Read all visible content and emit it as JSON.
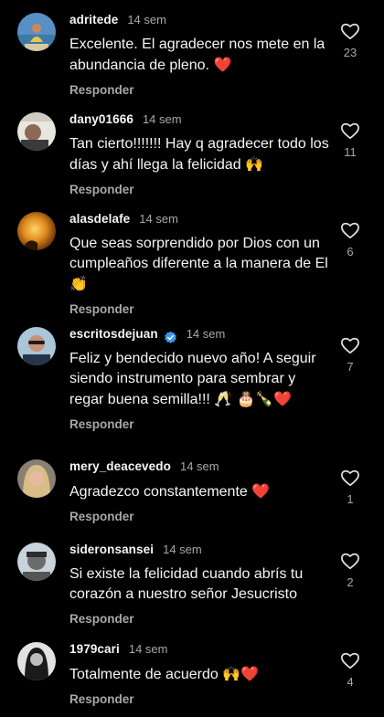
{
  "reply_label": "Responder",
  "comments": [
    {
      "username": "adritede",
      "time": "14 sem",
      "text": "Excelente.  El agradecer nos mete en la abundancia de pleno.",
      "emoji": "❤️",
      "likes": "23",
      "avatar_icon": "avatar-beach-photo"
    },
    {
      "username": "dany01666",
      "time": "14 sem",
      "text": "Tan cierto!!!!!!! Hay q agradecer todo los días y ahí llega la felicidad",
      "emoji": "🙌",
      "likes": "11",
      "avatar_icon": "avatar-man-photo"
    },
    {
      "username": "alasdelafe",
      "time": "14 sem",
      "text": "Que seas sorprendido por Dios con un cumpleaños diferente a la manera de El",
      "emoji": "👏",
      "likes": "6",
      "avatar_icon": "avatar-sunset-photo"
    },
    {
      "username": "escritosdejuan",
      "time": "14 sem",
      "text": "Feliz y bendecido nuevo año! A seguir siendo instrumento para sembrar y regar buena semilla!!!",
      "emoji": "🥂 🎂🍾❤️",
      "likes": "7",
      "avatar_icon": "avatar-man-sunglasses-photo",
      "verified": true
    },
    {
      "username": "mery_deacevedo",
      "time": "14 sem",
      "text": "Agradezco constantemente",
      "emoji": "❤️",
      "likes": "1",
      "avatar_icon": "avatar-woman-blonde-photo"
    },
    {
      "username": "sideronsansei",
      "time": "14 sem",
      "text": "Si existe la felicidad cuando abrís tu corazón a nuestro señor Jesucristo",
      "emoji": "",
      "likes": "2",
      "avatar_icon": "avatar-man-hat-photo"
    },
    {
      "username": "1979cari",
      "time": "14 sem",
      "text": "Totalmente de acuerdo",
      "emoji": "🙌❤️",
      "likes": "4",
      "avatar_icon": "avatar-woman-bw-photo"
    }
  ]
}
